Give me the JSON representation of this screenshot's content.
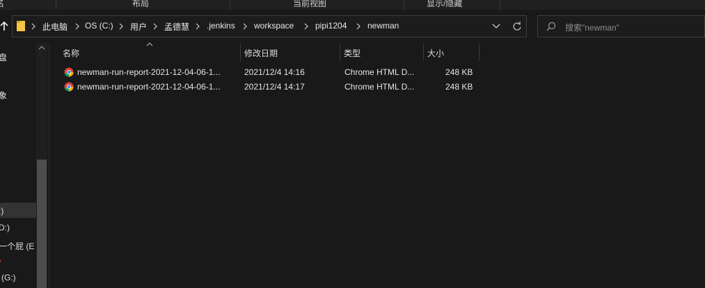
{
  "ribbon": {
    "tabs": [
      "名",
      "布局",
      "当前视图",
      "显示/隐藏"
    ]
  },
  "address_bar": {
    "breadcrumbs": [
      "此电脑",
      "OS (C:)",
      "用户",
      "孟德慧",
      ".jenkins",
      "workspace",
      "pipi1204",
      "newman"
    ],
    "up_icon": "up-arrow-icon",
    "dropdown_icon": "chevron-down-icon",
    "refresh_icon": "refresh-icon"
  },
  "search": {
    "placeholder": "搜索\"newman\""
  },
  "nav_pane": {
    "items": [
      "盘",
      "象",
      ":)",
      "D:)",
      "一个屁 (E",
      "(G:)"
    ]
  },
  "columns": [
    "名称",
    "修改日期",
    "类型",
    "大小"
  ],
  "files": [
    {
      "name": "newman-run-report-2021-12-04-06-1...",
      "modified": "2021/12/4 14:16",
      "type": "Chrome HTML D...",
      "size": "248 KB",
      "icon": "chrome-icon"
    },
    {
      "name": "newman-run-report-2021-12-04-06-1...",
      "modified": "2021/12/4 14:17",
      "type": "Chrome HTML D...",
      "size": "248 KB",
      "icon": "chrome-icon"
    }
  ],
  "colors": {
    "background": "#191919",
    "text": "#e6e6e6",
    "folder": "#f5c542",
    "selection": "#333333"
  }
}
